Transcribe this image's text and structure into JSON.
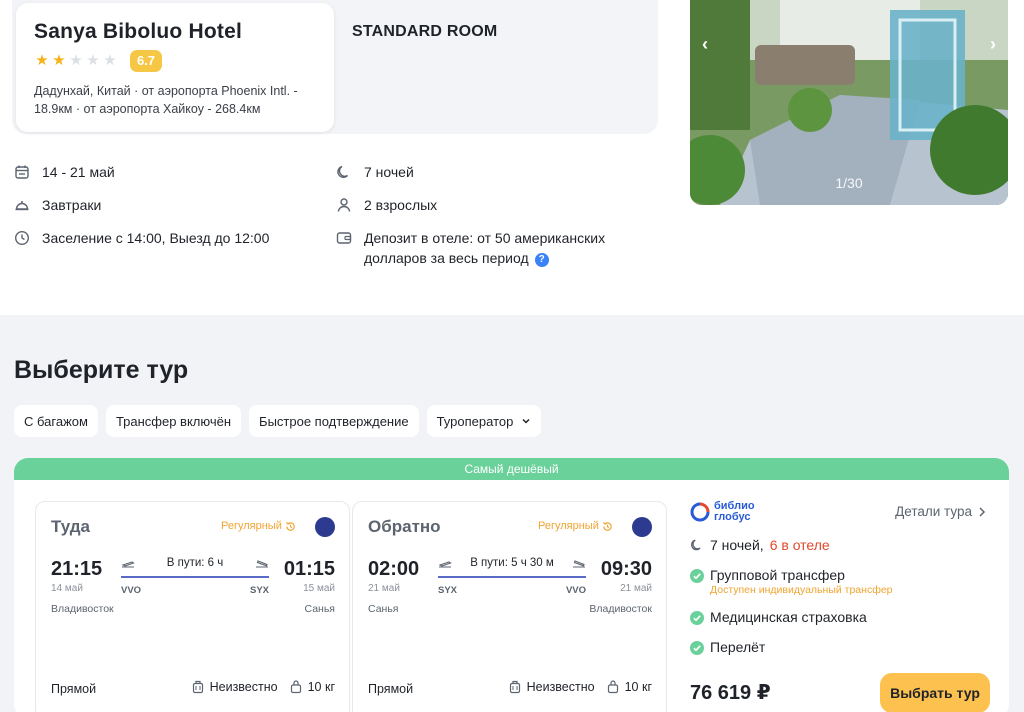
{
  "hotel": {
    "name": "Sanya Biboluo Hotel",
    "stars": 2,
    "stars_max": 5,
    "rating": "6.7",
    "location": "Дадунхай, Китай · от аэропорта Phoenix Intl. - 18.9км · от аэропорта Хайкоу - 268.4км",
    "room_type": "STANDARD ROOM"
  },
  "details": {
    "dates": "14 - 21 май",
    "nights": "7 ночей",
    "meal": "Завтраки",
    "guests": "2 взрослых",
    "checkin": "Заселение с 14:00, Выезд до 12:00",
    "deposit": "Депозит в отеле: от 50 американских долларов за весь период",
    "help_mark": "?"
  },
  "gallery": {
    "counter": "1/30",
    "prev": "‹",
    "next": "›"
  },
  "tours": {
    "title": "Выберите тур",
    "filters": [
      {
        "label": "С багажом"
      },
      {
        "label": "Трансфер включён"
      },
      {
        "label": "Быстрое подтверждение"
      },
      {
        "label": "Туроператор"
      }
    ],
    "offer": {
      "banner": "Самый дешёвый",
      "outbound": {
        "title": "Туда",
        "type": "Регулярный",
        "dep_time": "21:15",
        "dep_date": "14 май",
        "arr_time": "01:15",
        "arr_date": "15 май",
        "duration": "В пути: 6 ч",
        "from_code": "VVO",
        "to_code": "SYX",
        "from_city": "Владивосток",
        "to_city": "Санья",
        "stops": "Прямой",
        "luggage": "Неизвестно",
        "hand_luggage": "10 кг"
      },
      "inbound": {
        "title": "Обратно",
        "type": "Регулярный",
        "dep_time": "02:00",
        "dep_date": "21 май",
        "arr_time": "09:30",
        "arr_date": "21 май",
        "duration": "В пути: 5 ч 30 м",
        "from_code": "SYX",
        "to_code": "VVO",
        "from_city": "Санья",
        "to_city": "Владивосток",
        "stops": "Прямой",
        "luggage": "Неизвестно",
        "hand_luggage": "10 кг"
      },
      "operator": {
        "name_line1": "библио",
        "name_line2": "глобус"
      },
      "details_link": "Детали тура",
      "nights": "7 ночей,",
      "nights_in_hotel": "6 в отеле",
      "includes": [
        {
          "label": "Групповой трансфер",
          "sub": "Доступен индивидуальный трансфер"
        },
        {
          "label": "Медицинская страховка"
        },
        {
          "label": "Перелёт"
        }
      ],
      "price": "76 619 ₽",
      "select_label": "Выбрать тур"
    }
  },
  "colors": {
    "accent_green": "#6ad19a",
    "button_yellow": "#fcc14e",
    "rating_yellow": "#f6c744",
    "star": "#f6b21b",
    "highlight_red": "#e2492d",
    "flight_type": "#f0a430"
  }
}
